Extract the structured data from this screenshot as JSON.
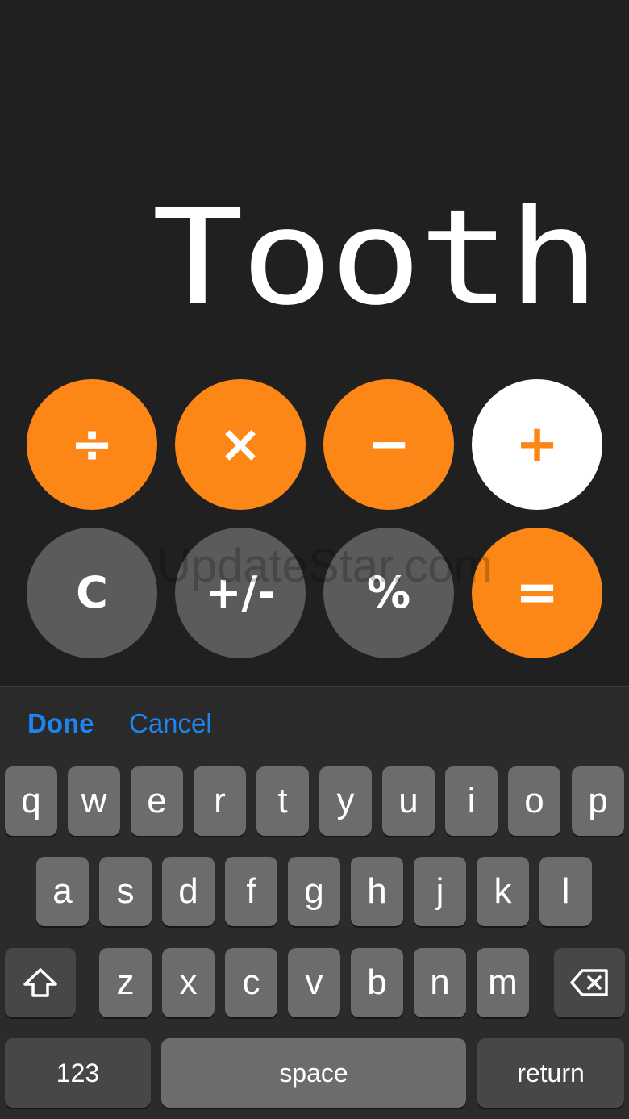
{
  "display": {
    "value": "Tooth"
  },
  "keypad": {
    "row1": [
      {
        "name": "divide-button",
        "label": "÷",
        "style": "orange"
      },
      {
        "name": "multiply-button",
        "label": "×",
        "style": "orange"
      },
      {
        "name": "minus-button",
        "label": "−",
        "style": "orange"
      },
      {
        "name": "plus-button",
        "label": "+",
        "style": "white"
      }
    ],
    "row2": [
      {
        "name": "clear-button",
        "label": "C",
        "style": "gray"
      },
      {
        "name": "sign-toggle-button",
        "label": "+/-",
        "style": "gray"
      },
      {
        "name": "percent-button",
        "label": "%",
        "style": "gray"
      },
      {
        "name": "equals-button",
        "label": "=",
        "style": "orange"
      }
    ]
  },
  "watermark": "UpdateStar.com",
  "toolbar": {
    "done_label": "Done",
    "cancel_label": "Cancel"
  },
  "keyboard": {
    "row1": [
      "q",
      "w",
      "e",
      "r",
      "t",
      "y",
      "u",
      "i",
      "o",
      "p"
    ],
    "row2": [
      "a",
      "s",
      "d",
      "f",
      "g",
      "h",
      "j",
      "k",
      "l"
    ],
    "row3": [
      "z",
      "x",
      "c",
      "v",
      "b",
      "n",
      "m"
    ],
    "numbers_label": "123",
    "space_label": "space",
    "return_label": "return",
    "shift_icon": "shift-arrow-icon",
    "delete_icon": "backspace-icon"
  },
  "colors": {
    "accent_orange": "#fd8716",
    "key_gray": "#5b5b5b",
    "link_blue": "#1e85f0"
  }
}
